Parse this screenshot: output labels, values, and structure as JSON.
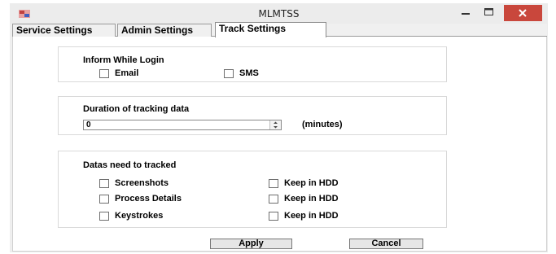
{
  "window": {
    "title": "MLMTSS"
  },
  "tabs": [
    {
      "label": "Service Settings"
    },
    {
      "label": "Admin Settings"
    },
    {
      "label": "Track Settings"
    }
  ],
  "inform": {
    "heading": "Inform While Login",
    "options": [
      {
        "label": "Email",
        "checked": false
      },
      {
        "label": "SMS",
        "checked": false
      }
    ]
  },
  "duration": {
    "heading": "Duration of tracking data",
    "value": "0",
    "unit": "(minutes)"
  },
  "datas": {
    "heading": "Datas need to tracked",
    "rows": [
      {
        "label": "Screenshots",
        "keep_label": "Keep in HDD"
      },
      {
        "label": "Process Details",
        "keep_label": "Keep in HDD"
      },
      {
        "label": "Keystrokes",
        "keep_label": "Keep in HDD"
      }
    ]
  },
  "buttons": {
    "apply": "Apply",
    "cancel": "Cancel"
  },
  "colors": {
    "close_button": "#c9473c",
    "titlebar": "#ececec"
  }
}
